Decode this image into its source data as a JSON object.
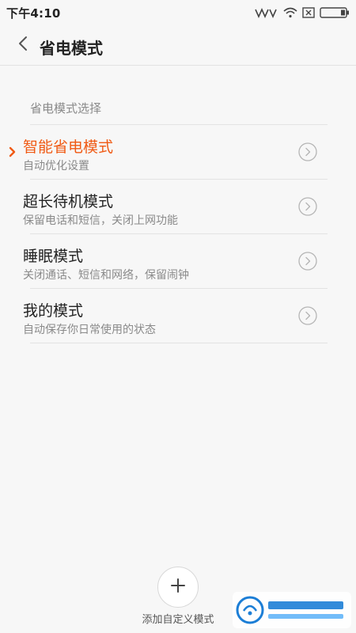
{
  "status_bar": {
    "time": "下午4:10",
    "icons": [
      "signal-icon",
      "wifi-icon",
      "sim-icon",
      "battery-icon"
    ]
  },
  "header": {
    "back_icon": "chevron-left-icon",
    "title": "省电模式"
  },
  "section": {
    "label": "省电模式选择"
  },
  "modes": [
    {
      "title": "智能省电模式",
      "subtitle": "自动优化设置",
      "selected": true
    },
    {
      "title": "超长待机模式",
      "subtitle": "保留电话和短信，关闭上网功能",
      "selected": false
    },
    {
      "title": "睡眠模式",
      "subtitle": "关闭通话、短信和网络，保留闹钟",
      "selected": false
    },
    {
      "title": "我的模式",
      "subtitle": "自动保存你日常使用的状态",
      "selected": false
    }
  ],
  "add_mode": {
    "label": "添加自定义模式"
  },
  "colors": {
    "accent": "#f05a14",
    "background": "#f7f7f7",
    "divider": "#e3e3e3",
    "secondary_text": "#8a8a8a"
  }
}
